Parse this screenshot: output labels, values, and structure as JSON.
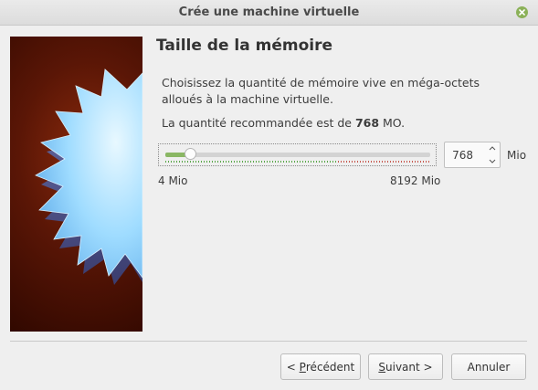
{
  "window": {
    "title": "Crée une machine virtuelle"
  },
  "page": {
    "heading": "Taille de la mémoire",
    "description": "Choisissez la quantité de mémoire vive en méga-octets alloués à la machine virtuelle.",
    "recommend_prefix": "La quantité recommandée est de ",
    "recommend_value": "768",
    "recommend_suffix": " MO."
  },
  "memory": {
    "value": "768",
    "min": 4,
    "max": 8192,
    "current": 768,
    "safe_limit_fraction": 0.65,
    "min_label": "4 Mio",
    "max_label": "8192 Mio",
    "unit": "Mio"
  },
  "buttons": {
    "prev_mnemonic": "P",
    "prev_rest": "récédent",
    "prev_prefix": "< ",
    "next_mnemonic": "S",
    "next_rest": "uivant",
    "next_suffix": " >",
    "cancel": "Annuler"
  },
  "colors": {
    "accent": "#8ab764",
    "close": "#8bb158",
    "banner": "#5a1606"
  },
  "icons": {
    "close": "close-icon",
    "spin_up": "chevron-up-icon",
    "spin_down": "chevron-down-icon",
    "banner": "starburst-illustration"
  }
}
